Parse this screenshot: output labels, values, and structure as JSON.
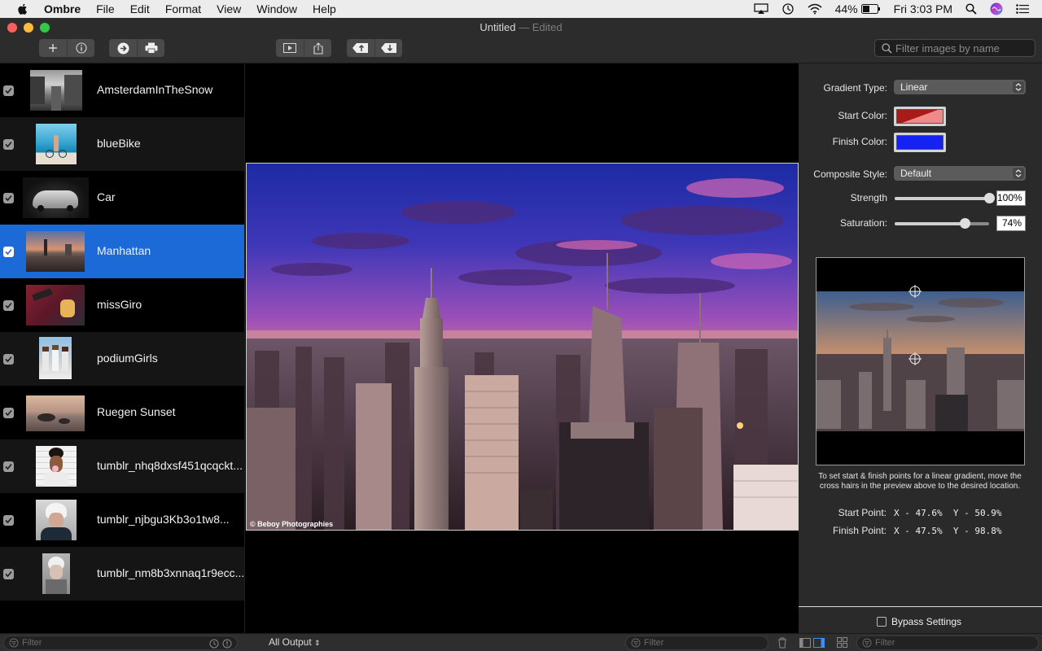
{
  "menubar": {
    "app_name": "Ombre",
    "items": [
      "File",
      "Edit",
      "Format",
      "View",
      "Window",
      "Help"
    ],
    "battery": "44%",
    "clock": "Fri 3:03 PM"
  },
  "window": {
    "title": "Untitled",
    "subtitle": "— Edited"
  },
  "toolbar": {
    "search_placeholder": "Filter images by name"
  },
  "sidebar": {
    "items": [
      {
        "label": "AmsterdamInTheSnow",
        "checked": true
      },
      {
        "label": "blueBike",
        "checked": true
      },
      {
        "label": "Car",
        "checked": true
      },
      {
        "label": "Manhattan",
        "checked": true,
        "selected": true
      },
      {
        "label": "missGiro",
        "checked": true
      },
      {
        "label": "podiumGirls",
        "checked": true
      },
      {
        "label": "Ruegen Sunset",
        "checked": true
      },
      {
        "label": "tumblr_nhq8dxsf451qcqckt...",
        "checked": true
      },
      {
        "label": "tumblr_njbgu3Kb3o1tw8...",
        "checked": true
      },
      {
        "label": "tumblr_nm8b3xnnaq1r9ecc...",
        "checked": true
      }
    ]
  },
  "main": {
    "credit": "© Beboy Photographies"
  },
  "inspector": {
    "gradient_type_label": "Gradient Type:",
    "gradient_type_value": "Linear",
    "start_color_label": "Start Color:",
    "finish_color_label": "Finish Color:",
    "composite_style_label": "Composite Style:",
    "composite_style_value": "Default",
    "strength_label": "Strength",
    "strength_value": "100%",
    "strength_fraction": 1.0,
    "saturation_label": "Saturation:",
    "saturation_value": "74%",
    "saturation_fraction": 0.74,
    "hint": "To set start & finish points for a linear gradient, move the cross hairs in the preview above to the desired location.",
    "start_point_label": "Start Point:",
    "start_point_value": "X - 47.6%  Y - 50.9%",
    "finish_point_label": "Finish Point:",
    "finish_point_value": "X - 47.5%  Y - 98.8%",
    "bypass_label": "Bypass Settings",
    "bypass_checked": false,
    "colors": {
      "start": "#b01f1f",
      "finish": "#1422f2"
    }
  },
  "bottombar": {
    "filter_placeholder": "Filter",
    "output_label": "All Output",
    "mid_filter_placeholder": "Filter",
    "right_filter_placeholder": "Filter"
  }
}
